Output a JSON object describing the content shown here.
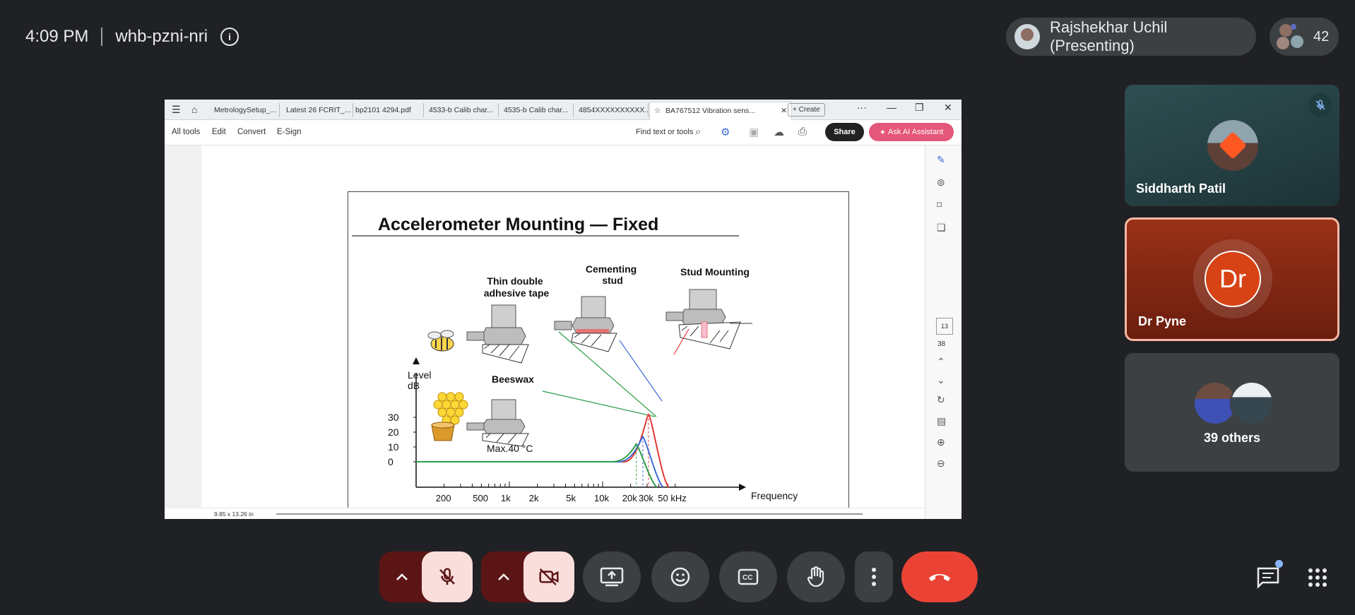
{
  "meeting": {
    "time": "4:09 PM",
    "code": "whb-pzni-nri",
    "presenter": "Rajshekhar Uchil (Presenting)",
    "participant_count": "42"
  },
  "acrobat": {
    "tabs": [
      "MetrologySetup_...",
      "Latest 26 FCRIT_...",
      "bp2101 4294.pdf",
      "4533-b Calib char...",
      "4535-b Calib char...",
      "4854XXXXXXXXXX...",
      "BA767512 Vibration sens..."
    ],
    "create_label": "Create",
    "menu": [
      "All tools",
      "Edit",
      "Convert",
      "E-Sign"
    ],
    "find_label": "Find text or tools",
    "share_label": "Share",
    "ai_label": "Ask AI Assistant",
    "page_current": "13",
    "page_total": "38",
    "page_dims": "9.85 x 13.26 in"
  },
  "slide": {
    "title": "Accelerometer Mounting — Fixed",
    "labels": {
      "thin_tape": [
        "Thin double",
        "adhesive tape"
      ],
      "cementing": [
        "Cementing",
        "stud"
      ],
      "stud": "Stud Mounting",
      "beeswax": "Beeswax",
      "max_temp": "Max.40 °C",
      "level": [
        "Level",
        "dB"
      ],
      "frequency": "Frequency"
    }
  },
  "chart_data": {
    "type": "line",
    "ylabel": "Level dB",
    "xlabel": "Frequency",
    "y_ticks": [
      "30",
      "20",
      "10",
      "0"
    ],
    "x_ticks": [
      "200",
      "500",
      "1k",
      "2k",
      "5k",
      "10k",
      "20k",
      "30k",
      "50 kHz"
    ],
    "series": [
      {
        "name": "Stud Mounting",
        "color": "#e53935",
        "resonance_hz": 31000,
        "peak_db": 32
      },
      {
        "name": "Cementing stud",
        "color": "#3f6ad8",
        "resonance_hz": 27000,
        "peak_db": 17
      },
      {
        "name": "Thin double adhesive tape",
        "color": "#2e9e48",
        "resonance_hz": 23000,
        "peak_db": 12
      },
      {
        "name": "Beeswax",
        "color": "#2e9e48",
        "resonance_hz": 23000,
        "peak_db": 12
      }
    ]
  },
  "tiles": [
    {
      "name": "Siddharth Patil"
    },
    {
      "name": "Dr Pyne",
      "initials": "Dr"
    },
    {
      "name": "39 others"
    }
  ],
  "colors": {
    "end_call": "#ea4335",
    "muted_bg": "#f9dedc",
    "active_speaker_border": "#f7b8a4"
  }
}
